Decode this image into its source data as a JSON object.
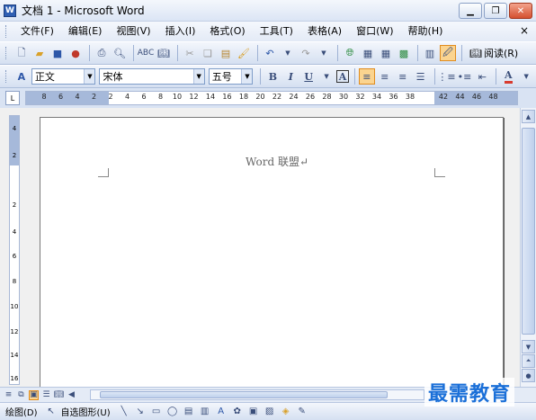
{
  "window": {
    "title": "文档 1 - Microsoft Word",
    "app_icon": "W",
    "controls": [
      "minimize-icon",
      "restore-icon",
      "close-icon"
    ]
  },
  "menubar": {
    "items": [
      {
        "label": "文件(F)"
      },
      {
        "label": "编辑(E)"
      },
      {
        "label": "视图(V)"
      },
      {
        "label": "插入(I)"
      },
      {
        "label": "格式(O)"
      },
      {
        "label": "工具(T)"
      },
      {
        "label": "表格(A)"
      },
      {
        "label": "窗口(W)"
      },
      {
        "label": "帮助(H)"
      }
    ],
    "close_glyph": "×"
  },
  "standard_toolbar": {
    "read_label": "阅读(R)"
  },
  "format_toolbar": {
    "style_value": "正文",
    "font_value": "宋体",
    "size_value": "五号",
    "bold": "B",
    "italic": "I",
    "underline": "U",
    "char_border": "A",
    "font_color": "A",
    "accent_color": "#d83b2f"
  },
  "ruler": {
    "ticks": [
      "8",
      "6",
      "4",
      "2",
      "2",
      "4",
      "6",
      "8",
      "10",
      "12",
      "14",
      "16",
      "18",
      "20",
      "22",
      "24",
      "26",
      "28",
      "30",
      "32",
      "34",
      "36",
      "38",
      "42",
      "44",
      "46",
      "48"
    ],
    "corner_label": "L",
    "v_ticks": [
      "4",
      "2",
      "2",
      "4",
      "6",
      "8",
      "10",
      "12",
      "14",
      "16"
    ]
  },
  "document": {
    "text": "Word 联盟↵"
  },
  "drawing_toolbar": {
    "draw_label": "绘图(D)",
    "autoshape_label": "自选图形(U)"
  },
  "watermark": {
    "text": "最需教育"
  },
  "colors": {
    "title_bar": "#dbe5f5",
    "toolbar": "#d5e0f1",
    "active_button": "#fbd48f",
    "watermark": "#1a6fd8"
  }
}
